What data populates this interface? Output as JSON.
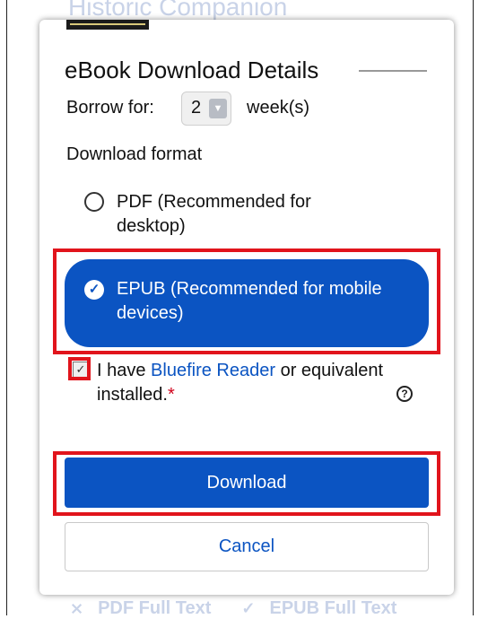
{
  "background": {
    "title": "Historic Companion",
    "links": [
      "PDF Full Text",
      "EPUB Full Text"
    ]
  },
  "dialog": {
    "heading": "eBook Download Details",
    "borrow": {
      "label": "Borrow for:",
      "value": "2",
      "unit": "week(s)"
    },
    "format_label": "Download format",
    "options": [
      {
        "label": "PDF (Recommended for desktop)",
        "selected": false
      },
      {
        "label": "EPUB (Recommended for mobile devices)",
        "selected": true
      }
    ],
    "agreement": {
      "checked": true,
      "prefix": "I have ",
      "link": "Bluefire Reader",
      "suffix": " or equivalent installed.",
      "required_mark": "*",
      "help_icon": "?"
    },
    "download_label": "Download",
    "cancel_label": "Cancel"
  },
  "colors": {
    "primary": "#0b54c2",
    "highlight": "#e1141c",
    "required": "#d0021b"
  }
}
